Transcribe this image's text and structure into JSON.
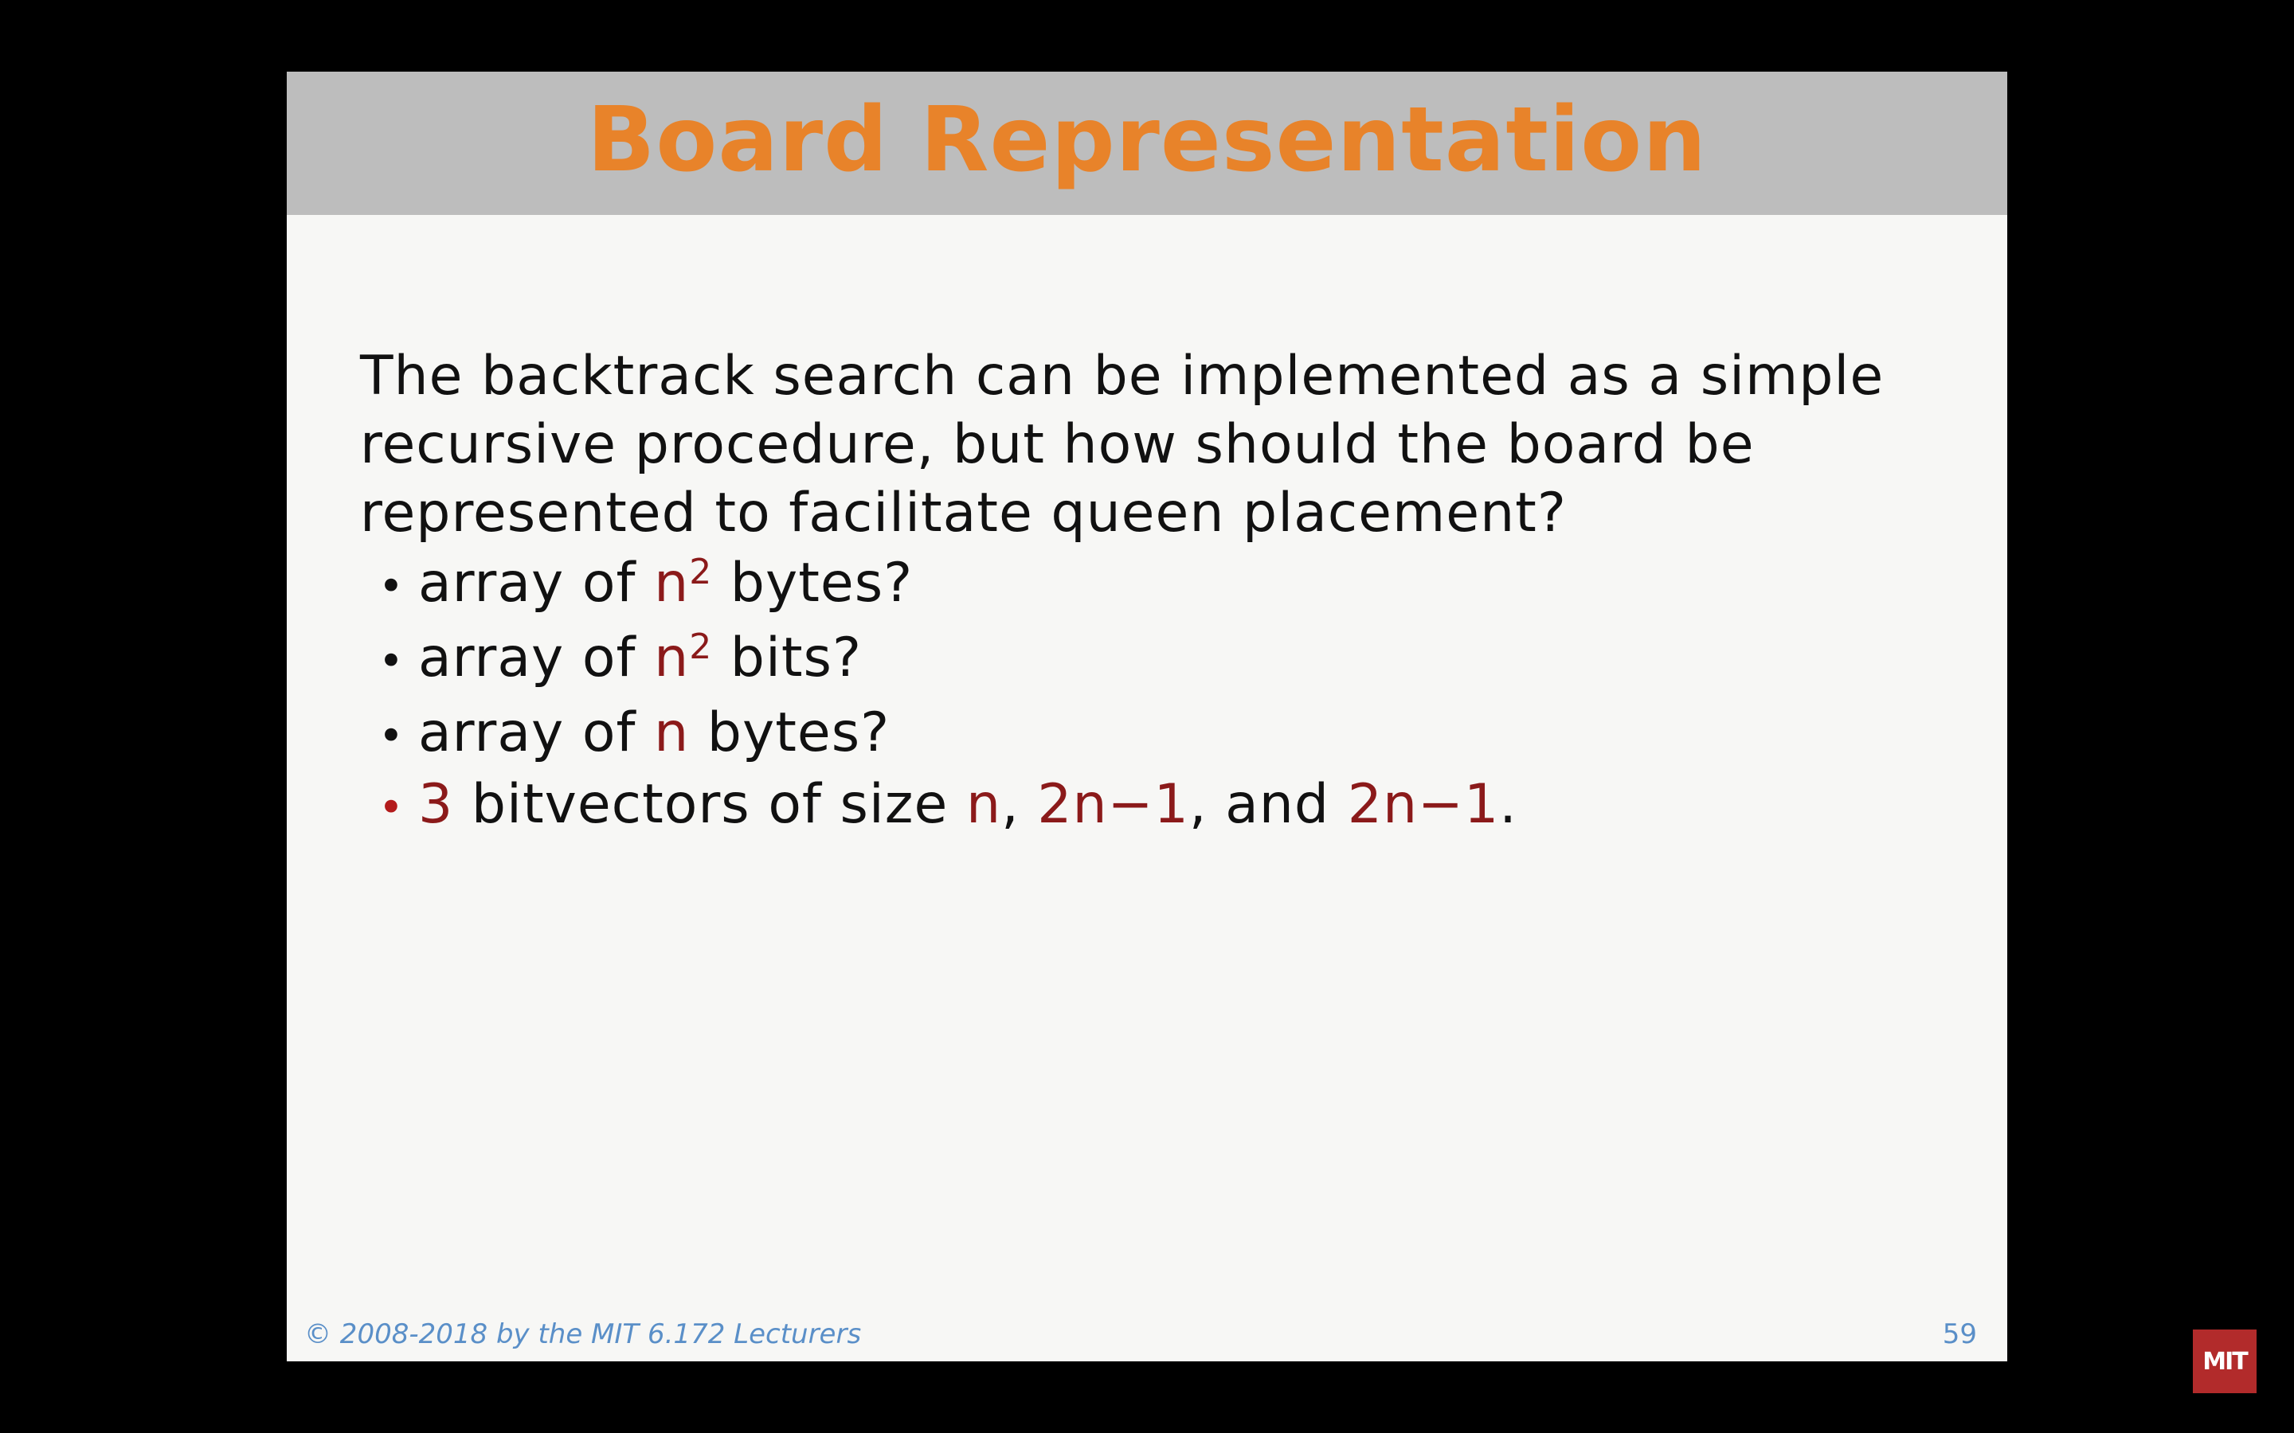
{
  "slide": {
    "title": "Board Representation",
    "paragraph": [
      "The backtrack search can be implemented as a simple",
      "recursive procedure, but how should the board be",
      "represented to facilitate queen placement?"
    ],
    "bullets": [
      {
        "pre": "array of ",
        "var": "n",
        "sup": "2",
        "post": " bytes?"
      },
      {
        "pre": "array of ",
        "var": "n",
        "sup": "2",
        "post": " bits?"
      },
      {
        "pre": "array of ",
        "var": "n",
        "post": " bytes?"
      },
      {
        "num": "3",
        "t1": " bitvectors of size ",
        "v1": "n",
        "t2": ", ",
        "v2": "2n−1",
        "t3": ", and ",
        "v3": "2n−1",
        "t4": "."
      }
    ],
    "footer_copyright": "© 2008-2018 by the MIT 6.172 Lecturers",
    "page_number": "59"
  },
  "logo": {
    "text": "MIT"
  },
  "colors": {
    "title": "#e8832a",
    "title_bar": "#bdbdbd",
    "highlight": "#8b1a1a",
    "footer": "#5a8fc8",
    "logo_bg": "#b22b2b"
  }
}
